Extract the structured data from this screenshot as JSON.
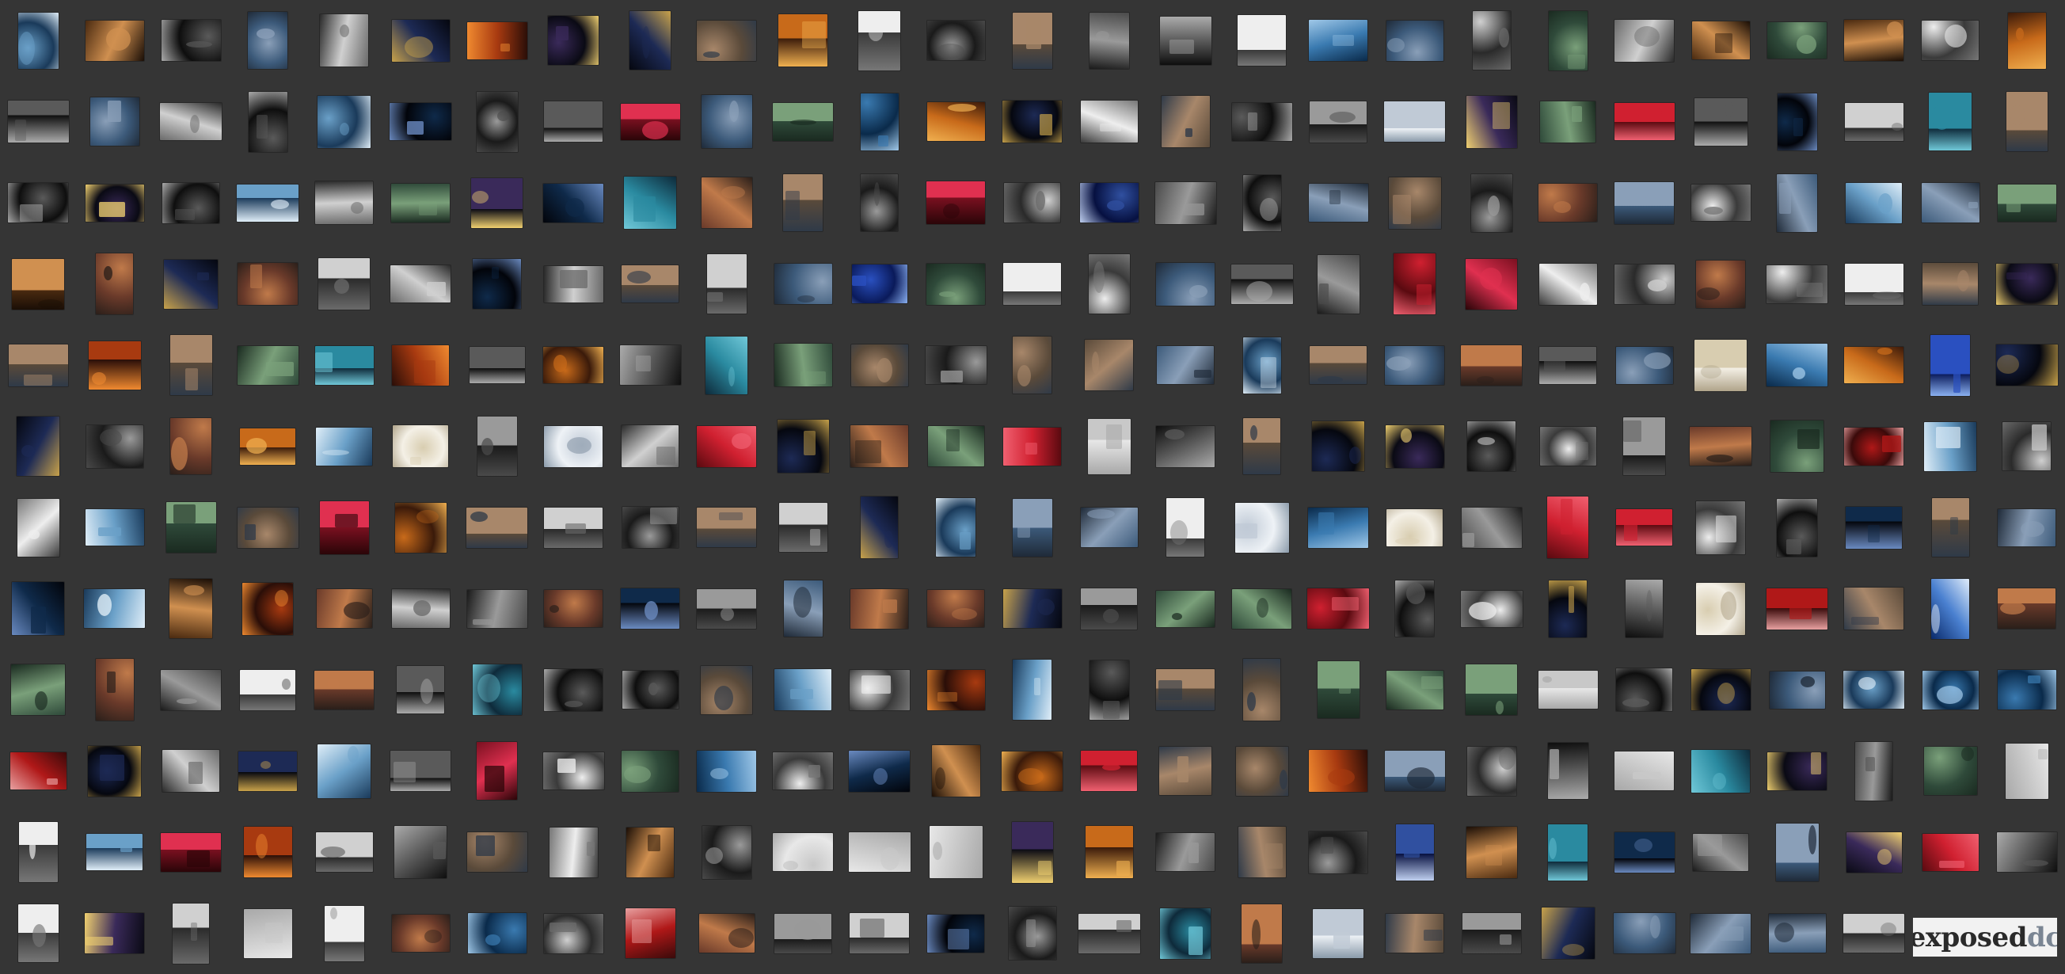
{
  "page": {
    "background_color": "#353535"
  },
  "mosaic": {
    "columns": 27,
    "rows": 12,
    "style": "grid of photo thumbnails (color and black-and-white street, landmark, night and portrait photography)",
    "thumbnail_themes": [
      "color",
      "bw",
      "night",
      "warm",
      "cool",
      "bright",
      "red",
      "blue"
    ]
  },
  "brand": {
    "word": "exposed",
    "accent": "dc",
    "word_color": "#2a2a2a",
    "accent_color": "#7a8593",
    "tile_color": "#f2f2f2"
  }
}
